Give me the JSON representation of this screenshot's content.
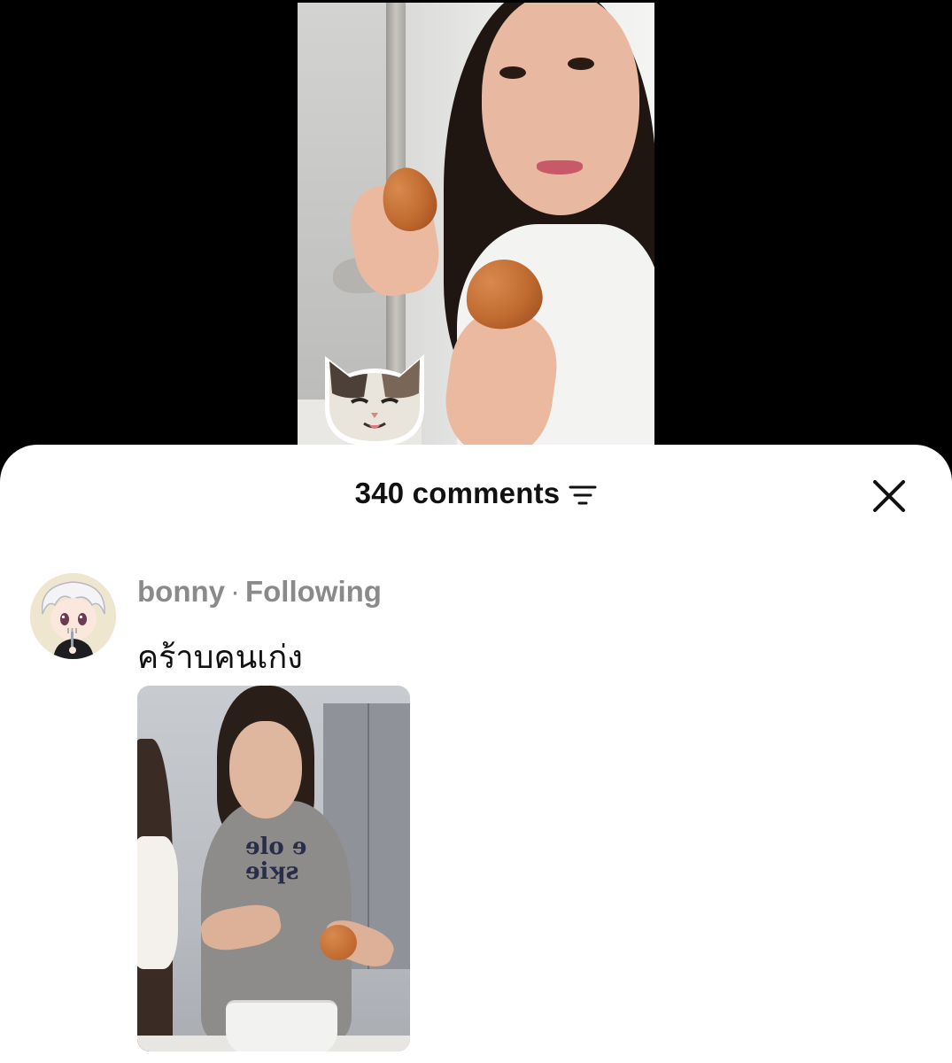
{
  "sheet": {
    "comments_count": "340 comments"
  },
  "comment": {
    "username": "bonny",
    "separator": "·",
    "relation": "Following",
    "text": "คร้าบคนเก่ง",
    "media_print": "ɘlo ɘ\nɘiʞƨ"
  },
  "icons": {
    "filter": "filter-sort-icon",
    "close": "close-icon"
  },
  "colors": {
    "sheet_background": "#ffffff",
    "page_background": "#000000",
    "meta_text": "#8a8a8a",
    "primary_text": "#111111"
  }
}
